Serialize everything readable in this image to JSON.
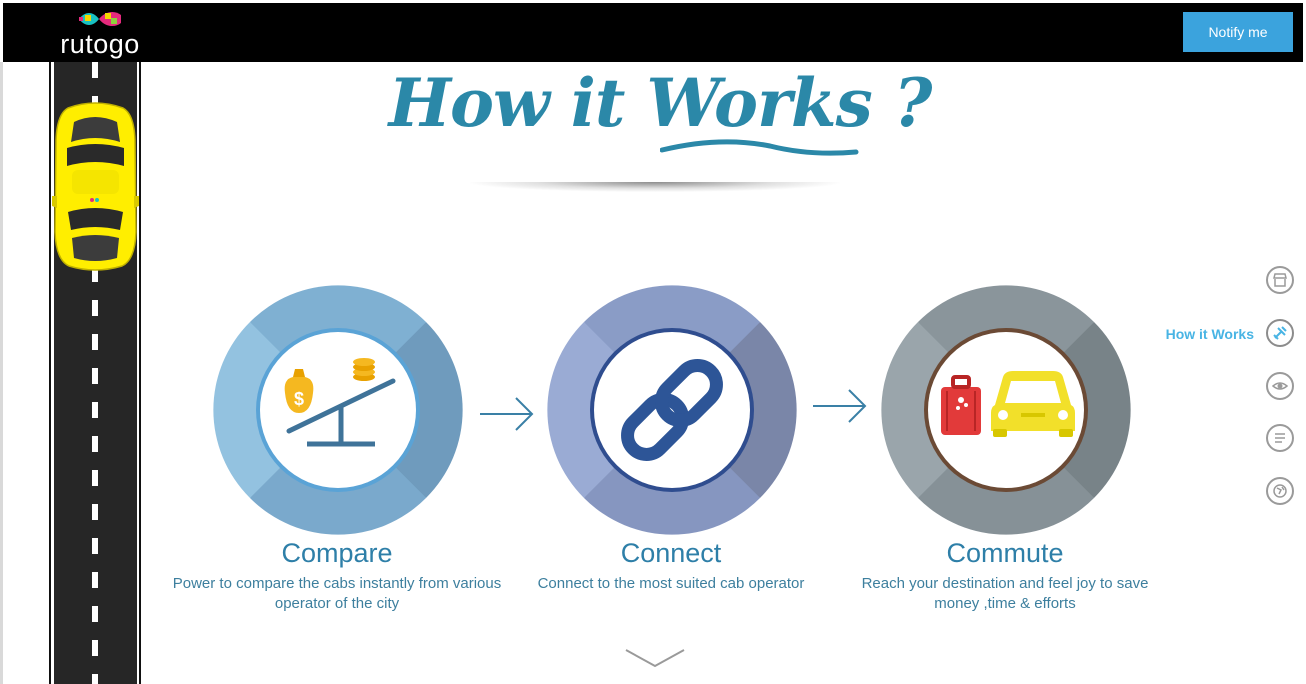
{
  "header": {
    "logo_text": "rutogo",
    "notify_label": "Notify me"
  },
  "section": {
    "title": "How it Works ?"
  },
  "steps": [
    {
      "name": "Compare",
      "description": "Power to compare the cabs instantly from various operator of the city",
      "icon": "seesaw-money-icon"
    },
    {
      "name": "Connect",
      "description": "Connect to the most suited cab operator",
      "icon": "chain-link-icon"
    },
    {
      "name": "Commute",
      "description": "Reach your destination and feel joy to save money ,time & efforts",
      "icon": "luggage-car-icon"
    }
  ],
  "side_nav": {
    "active_label": "How it Works",
    "items": [
      "store-icon",
      "tools-icon",
      "eye-icon",
      "list-icon",
      "globe-icon"
    ]
  },
  "colors": {
    "accent_blue": "#3ba3dd",
    "title_teal": "#2b88a8",
    "step_text": "#2e7fa8",
    "nav_active": "#48b4e4",
    "car_yellow": "#ffee00"
  }
}
